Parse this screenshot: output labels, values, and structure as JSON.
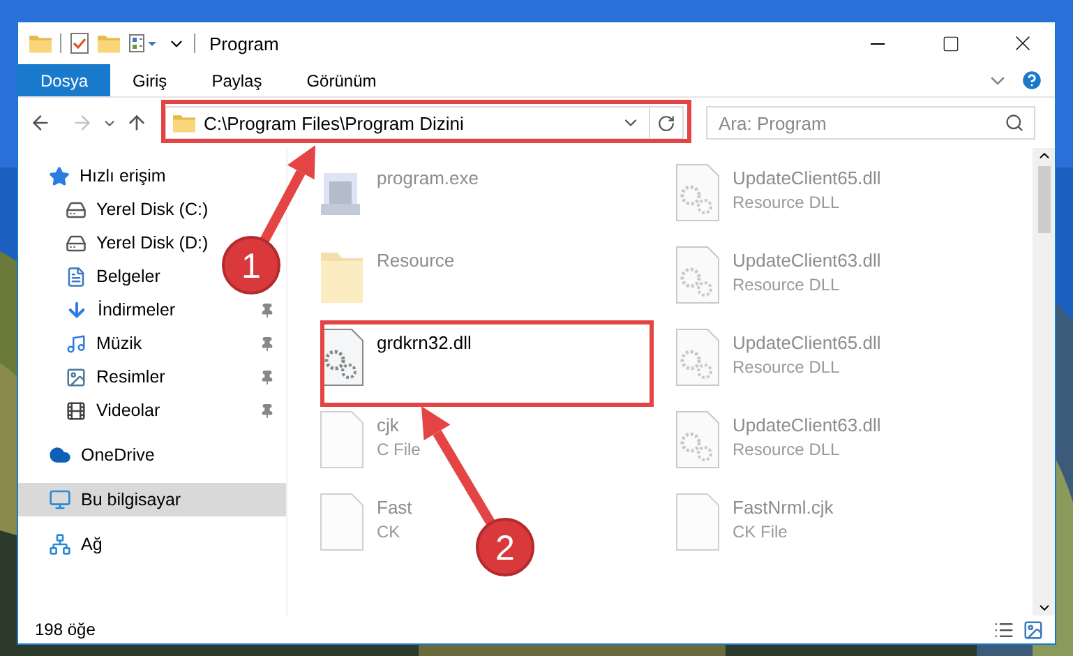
{
  "window": {
    "title": "Program"
  },
  "ribbon_tabs": [
    {
      "label": "Dosya",
      "selected": true
    },
    {
      "label": "Giriş",
      "selected": false
    },
    {
      "label": "Paylaş",
      "selected": false
    },
    {
      "label": "Görünüm",
      "selected": false
    }
  ],
  "address_bar": {
    "path": "C:\\Program Files\\Program Dizini"
  },
  "search": {
    "placeholder": "Ara: Program"
  },
  "navigation": {
    "forward_disabled": true
  },
  "sidebar": [
    {
      "label": "Hızlı erişim",
      "selected": false,
      "children": [
        {
          "label": "Yerel Disk (C:)",
          "pinned": false
        },
        {
          "label": "Yerel Disk (D:)",
          "pinned": false
        },
        {
          "label": "Belgeler",
          "pinned": false
        },
        {
          "label": "İndirmeler",
          "pinned": true
        },
        {
          "label": "Müzik",
          "pinned": true
        },
        {
          "label": "Resimler",
          "pinned": true
        },
        {
          "label": "Videolar",
          "pinned": true
        }
      ]
    },
    {
      "label": "OneDrive",
      "selected": false
    },
    {
      "label": "Bu bilgisayar",
      "selected": true
    },
    {
      "label": "Ağ",
      "selected": false
    }
  ],
  "files": [
    {
      "kind": "exe",
      "name": "program.exe",
      "dimmed": true
    },
    {
      "kind": "dll",
      "name": "UpdateClient65.dll",
      "type": "Resource DLL",
      "dimmed": true
    },
    {
      "kind": "folder",
      "name": "Resource",
      "dimmed": true
    },
    {
      "kind": "dll",
      "name": "UpdateClient63.dll",
      "type": "Resource DLL",
      "dimmed": true
    },
    {
      "kind": "dll",
      "name": "grdkrn32.dll",
      "dimmed": false,
      "highlighted": true
    },
    {
      "kind": "dll",
      "name": "UpdateClient65.dll",
      "type": "Resource DLL",
      "dimmed": true
    },
    {
      "kind": "file",
      "name": "cjk",
      "type": "C File",
      "dimmed": true
    },
    {
      "kind": "dll",
      "name": "UpdateClient63.dll",
      "type": "Resource DLL",
      "dimmed": true
    },
    {
      "kind": "file",
      "name": "Fast",
      "type": "CK",
      "dimmed": true
    },
    {
      "kind": "file",
      "name": "FastNrml.cjk",
      "type": "CK File",
      "dimmed": true
    }
  ],
  "status_bar": {
    "item_count": "198 öğe"
  },
  "annotations": [
    {
      "number": "1"
    },
    {
      "number": "2"
    }
  ]
}
